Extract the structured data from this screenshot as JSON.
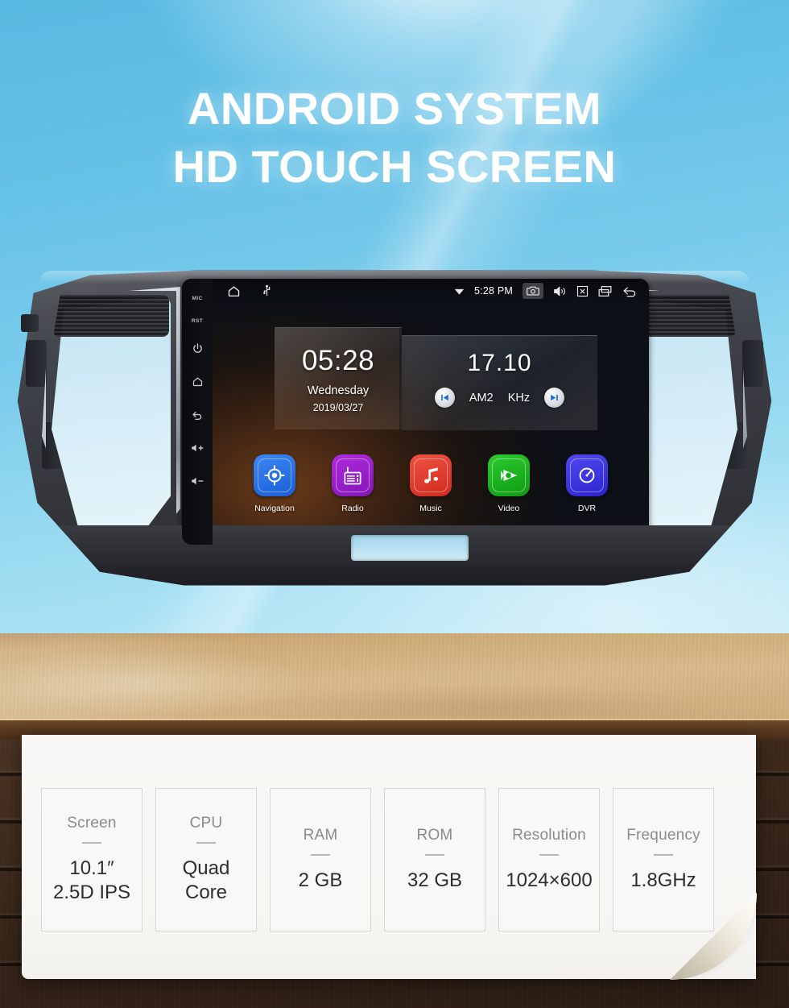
{
  "headline": {
    "line1": "ANDROID SYSTEM",
    "line2": "HD TOUCH SCREEN"
  },
  "head_unit": {
    "side_buttons": [
      {
        "name": "mic",
        "label": "MIC"
      },
      {
        "name": "reset",
        "label": "RST"
      },
      {
        "name": "power",
        "label": ""
      },
      {
        "name": "home",
        "label": ""
      },
      {
        "name": "back",
        "label": ""
      },
      {
        "name": "volume-up",
        "label": ""
      },
      {
        "name": "volume-down",
        "label": ""
      }
    ],
    "status_bar": {
      "home_icon": "home-icon",
      "usb_icon": "usb-icon",
      "wifi_icon": "wifi-icon",
      "time": "5:28 PM",
      "camera_icon": "camera-icon",
      "volume_icon": "volume-icon",
      "close_icon": "close-box-icon",
      "recents_icon": "recents-icon",
      "back_icon": "back-icon"
    },
    "clock_widget": {
      "time": "05:28",
      "weekday": "Wednesday",
      "date": "2019/03/27"
    },
    "radio_widget": {
      "frequency": "17.10",
      "band": "AM2",
      "unit": "KHz",
      "prev_icon": "skip-previous-icon",
      "next_icon": "skip-next-icon"
    },
    "apps": [
      {
        "label": "Navigation",
        "icon": "navigation-icon",
        "color": "#1f6fe8"
      },
      {
        "label": "Radio",
        "icon": "radio-icon",
        "color": "#9b1fc9"
      },
      {
        "label": "Music",
        "icon": "music-icon",
        "color": "#e13b2b"
      },
      {
        "label": "Video",
        "icon": "video-icon",
        "color": "#17b01c"
      },
      {
        "label": "DVR",
        "icon": "dvr-icon",
        "color": "#3a34e0"
      }
    ]
  },
  "specs": [
    {
      "title": "Screen",
      "value_line1": "10.1″",
      "value_line2": "2.5D IPS"
    },
    {
      "title": "CPU",
      "value_line1": "Quad",
      "value_line2": "Core"
    },
    {
      "title": "RAM",
      "value_line1": "2 GB",
      "value_line2": ""
    },
    {
      "title": "ROM",
      "value_line1": "32 GB",
      "value_line2": ""
    },
    {
      "title": "Resolution",
      "value_line1": "1024×600",
      "value_line2": ""
    },
    {
      "title": "Frequency",
      "value_line1": "1.8GHz",
      "value_line2": ""
    }
  ]
}
